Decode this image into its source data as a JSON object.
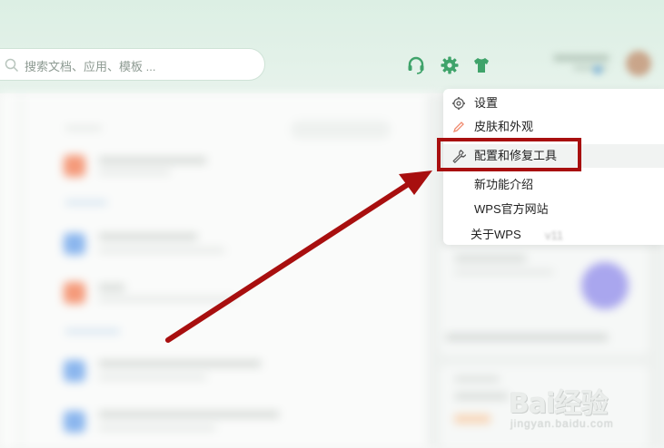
{
  "search": {
    "placeholder": "搜索文档、应用、模板 ..."
  },
  "toolbar": {
    "icons": [
      "headset-icon",
      "gear-icon",
      "tshirt-icon"
    ]
  },
  "menu": {
    "items": [
      {
        "label": "设置",
        "icon": "gear-icon"
      },
      {
        "label": "皮肤和外观",
        "icon": "pencil-icon"
      },
      {
        "label": "配置和修复工具",
        "icon": "wrench-icon"
      },
      {
        "label": "新功能介绍"
      },
      {
        "label": "WPS官方网站"
      },
      {
        "label": "关于WPS"
      }
    ],
    "version": "v11"
  },
  "annotation": {
    "color": "#a80f0f"
  },
  "watermark": {
    "brand": "Bai经验",
    "domain": "jingyan.baidu.com"
  },
  "colors": {
    "accent": "#3fa36a",
    "annotation": "#a80f0f"
  }
}
